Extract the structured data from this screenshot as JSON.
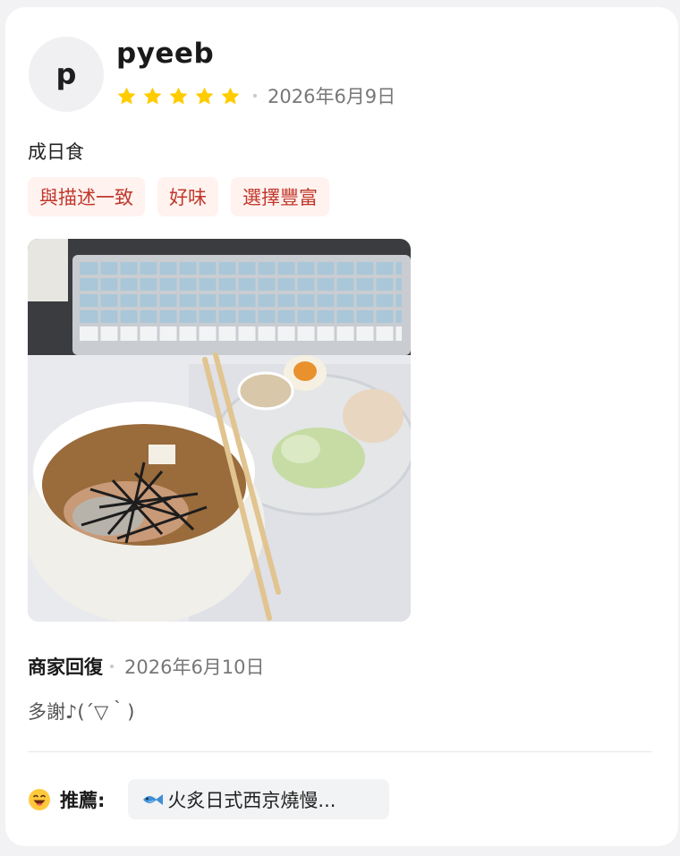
{
  "review": {
    "avatar_letter": "p",
    "username": "pyeeb",
    "rating": 5,
    "date": "2026年6月9日",
    "text": "成日食",
    "tags": [
      "與描述一致",
      "好味",
      "選擇豐富"
    ]
  },
  "merchant_reply": {
    "title": "商家回復",
    "date": "2026年6月10日",
    "text": "多謝♪(´▽｀)"
  },
  "recommendation": {
    "label": "推薦:",
    "icon": "fish-icon",
    "item": "火炙日式西京燒慢..."
  },
  "colors": {
    "star": "#ffcc00",
    "tag_bg": "#fff2ef",
    "tag_text": "#c0382b"
  }
}
